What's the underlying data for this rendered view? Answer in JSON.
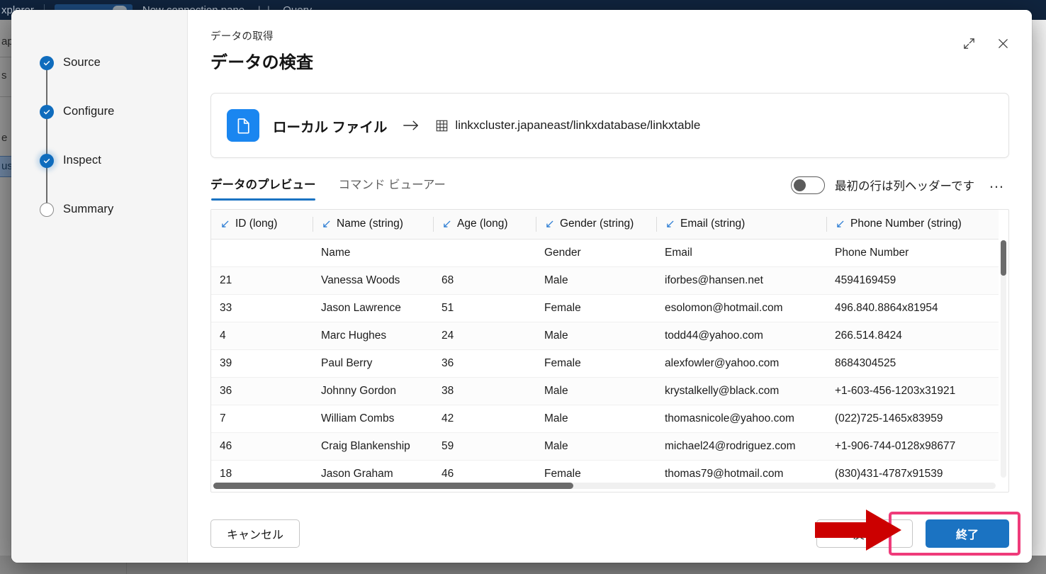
{
  "background": {
    "topbar": {
      "app_label": "xplorer",
      "menu_items": [
        "New connection pane",
        "Query"
      ]
    },
    "left_rail_fragments": [
      "ap",
      "s",
      "e",
      "us"
    ]
  },
  "dialog": {
    "eyebrow": "データの取得",
    "title": "データの検査",
    "expand_icon": "expand-icon",
    "close_icon": "close-icon",
    "stepper": [
      {
        "label": "Source",
        "state": "done"
      },
      {
        "label": "Configure",
        "state": "done"
      },
      {
        "label": "Inspect",
        "state": "current"
      },
      {
        "label": "Summary",
        "state": "todo"
      }
    ],
    "source_card": {
      "file_icon": "document-icon",
      "source_label": "ローカル ファイル",
      "arrow_icon": "arrow-right-icon",
      "table_icon": "table-icon",
      "destination": "linkxcluster.japaneast/linkxdatabase/linkxtable"
    },
    "tabs": [
      {
        "label": "データのプレビュー",
        "active": true
      },
      {
        "label": "コマンド ビューアー",
        "active": false
      }
    ],
    "header_toggle": {
      "label": "最初の行は列ヘッダーです",
      "on": false
    },
    "more_options": "…",
    "grid": {
      "columns": [
        {
          "name": "ID",
          "type": "long",
          "header": "ID (long)"
        },
        {
          "name": "Name",
          "type": "string",
          "header": "Name (string)"
        },
        {
          "name": "Age",
          "type": "long",
          "header": "Age (long)"
        },
        {
          "name": "Gender",
          "type": "string",
          "header": "Gender (string)"
        },
        {
          "name": "Email",
          "type": "string",
          "header": "Email (string)"
        },
        {
          "name": "Phone Number",
          "type": "string",
          "header": "Phone Number (string)"
        },
        {
          "name": "",
          "type": "",
          "header": ""
        }
      ],
      "rows": [
        [
          "",
          "Name",
          "",
          "Gender",
          "Email",
          "Phone Number"
        ],
        [
          "21",
          "Vanessa Woods",
          "68",
          "Male",
          "iforbes@hansen.net",
          "4594169459"
        ],
        [
          "33",
          "Jason Lawrence",
          "51",
          "Female",
          "esolomon@hotmail.com",
          "496.840.8864x81954"
        ],
        [
          "4",
          "Marc Hughes",
          "24",
          "Male",
          "todd44@yahoo.com",
          "266.514.8424"
        ],
        [
          "39",
          "Paul Berry",
          "36",
          "Female",
          "alexfowler@yahoo.com",
          "8684304525"
        ],
        [
          "36",
          "Johnny Gordon",
          "38",
          "Male",
          "krystalkelly@black.com",
          "+1-603-456-1203x31921"
        ],
        [
          "7",
          "William Combs",
          "42",
          "Male",
          "thomasnicole@yahoo.com",
          "(022)725-1465x83959"
        ],
        [
          "46",
          "Craig Blankenship",
          "59",
          "Male",
          "michael24@rodriguez.com",
          "+1-906-744-0128x98677"
        ],
        [
          "18",
          "Jason Graham",
          "46",
          "Female",
          "thomas79@hotmail.com",
          "(830)431-4787x91539"
        ]
      ],
      "vertical_scroll_thumb_pct": 15,
      "horizontal_scroll_thumb_pct": 46
    },
    "footer": {
      "cancel_label": "キャンセル",
      "back_label": "戻る",
      "finish_label": "終了"
    }
  },
  "annotations": {
    "highlight_color": "#ef3b7a",
    "arrow_color": "#cc0000",
    "highlight_target": "finish-button",
    "arrow_target": "back-button"
  },
  "colors": {
    "accent": "#1b73c2",
    "step_done": "#0f6cbd",
    "file_badge": "#1a86f0",
    "type_icon": "#2b7cd3"
  }
}
